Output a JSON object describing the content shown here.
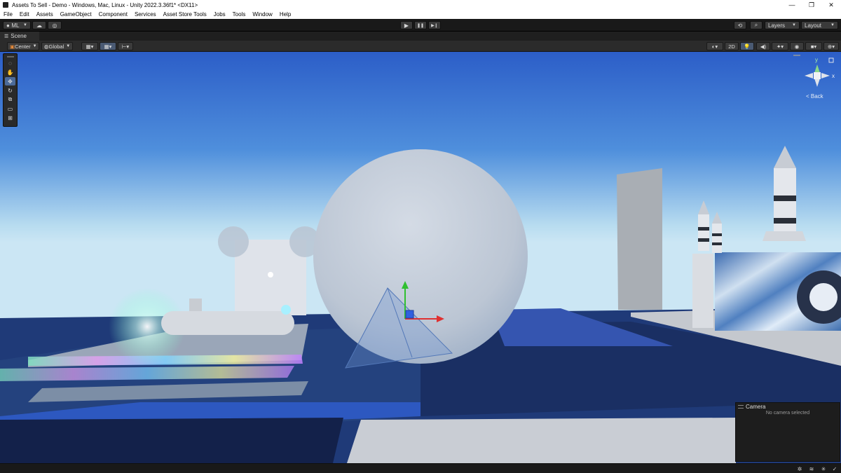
{
  "window": {
    "title": "Assets To Sell - Demo - Windows, Mac, Linux - Unity 2022.3.36f1* <DX11>",
    "controls": {
      "minimize": "—",
      "restore": "❐",
      "close": "✕"
    }
  },
  "menu": [
    "File",
    "Edit",
    "Assets",
    "GameObject",
    "Component",
    "Services",
    "Asset Store Tools",
    "Jobs",
    "Tools",
    "Window",
    "Help"
  ],
  "toolbar": {
    "account_label": "ML",
    "play_icon": "▶",
    "pause_icon": "❚❚",
    "step_icon": "▶❙",
    "layers_label": "Layers",
    "layout_label": "Layout"
  },
  "scene_tab": {
    "label": "Scene"
  },
  "scene_toolbar": {
    "pivot_label": "Center",
    "space_label": "Global",
    "mode_2d_label": "2D"
  },
  "gizmo": {
    "y_label": "y",
    "x_label": "x",
    "view_label": "< Back"
  },
  "camera_overlay": {
    "title": "Camera",
    "message": "No camera selected"
  },
  "colors": {
    "sky_top": "#2f62c9",
    "sky_horizon": "#b6dcf2",
    "accent_blue": "#4c6b9a",
    "axis_x": "#e03030",
    "axis_y": "#30c030",
    "axis_z": "#3060e0"
  }
}
